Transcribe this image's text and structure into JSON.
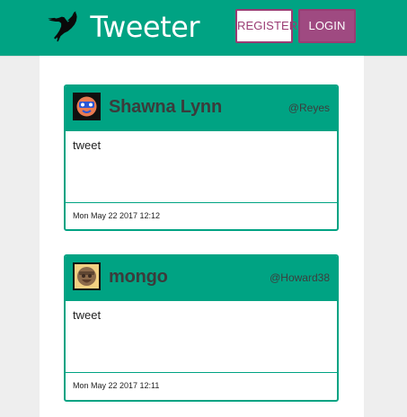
{
  "header": {
    "brand_title": "Tweeter",
    "register_label": "REGISTER",
    "login_label": "LOGIN",
    "icon": "hummingbird-icon"
  },
  "colors": {
    "primary": "#00A383",
    "accent": "#9F4A81",
    "panel": "#FFFFFF",
    "background": "#EEEEEE",
    "text": "#333333"
  },
  "tweets": [
    {
      "name": "Shawna Lynn",
      "handle": "@Reyes",
      "text": "tweet",
      "timestamp": "Mon May 22 2017 12:12",
      "avatar": "orange-face-with-blue-goggles-avatar"
    },
    {
      "name": "mongo",
      "handle": "@Howard38",
      "text": "tweet",
      "timestamp": "Mon May 22 2017 12:11",
      "avatar": "brown-bearded-face-avatar"
    }
  ]
}
